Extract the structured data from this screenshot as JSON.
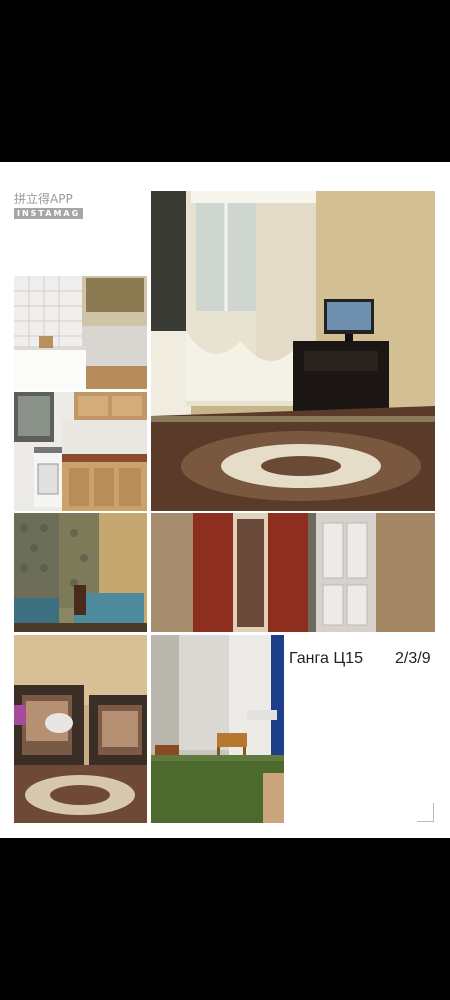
{
  "watermark": {
    "app_name": "拼立得APP",
    "brand": "INSTAMAG"
  },
  "caption": {
    "title": "Ганга Ц15",
    "numbers": "2/3/9"
  },
  "photos": [
    {
      "id": "living-room-carpet-tv"
    },
    {
      "id": "kitchen-tiles-table"
    },
    {
      "id": "kitchen-cabinets-stove"
    },
    {
      "id": "bedroom-two-beds"
    },
    {
      "id": "wardrobe-hallway"
    },
    {
      "id": "armchairs-room"
    },
    {
      "id": "balcony-room"
    }
  ]
}
